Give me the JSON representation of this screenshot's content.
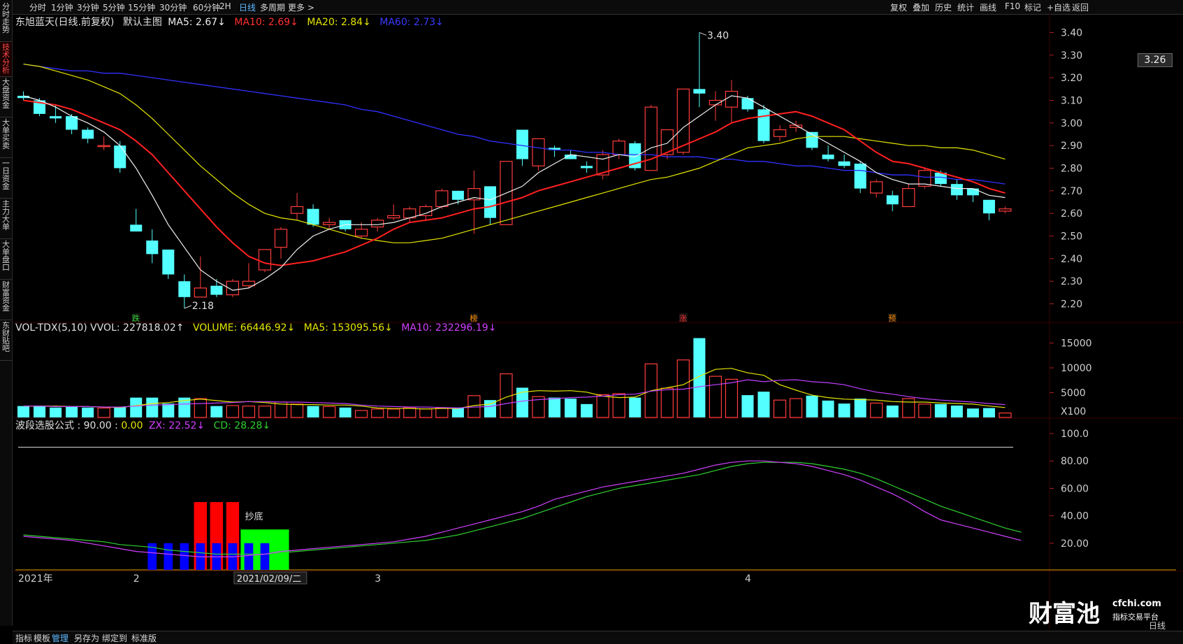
{
  "side_tabs": [
    "分时走势",
    "技术分析",
    "大盘资金",
    "大单买卖",
    "一日资金",
    "主力大单",
    "大单盘口",
    "财富资金",
    "东财贴吧"
  ],
  "side_active": 1,
  "periods": [
    "分时",
    "1分钟",
    "3分钟",
    "5分钟",
    "15分钟",
    "30分钟",
    "60分钟",
    "2H",
    "日线",
    "多周期",
    "更多 >"
  ],
  "period_active": 8,
  "right_tools": [
    "复权",
    "叠加",
    "历史",
    "统计",
    "画线",
    "F10",
    "标记",
    "+自选",
    "返回"
  ],
  "bottom_tools": [
    "指标",
    "模板",
    "管理",
    "另存为",
    "绑定到",
    "标准版"
  ],
  "bottom_active": 2,
  "colors": {
    "up": "#ff3c3c",
    "down": "#54ffff",
    "ma5": "#f0f0f0",
    "ma10": "#ff2020",
    "ma20": "#e5e500",
    "ma60": "#3030ff",
    "vol_ma5": "#e5e500",
    "vol_ma10": "#c040ff",
    "zx": "#d040ff",
    "cd": "#30d030"
  },
  "main_legend": {
    "stock": "东旭蓝天(日线.前复权)",
    "template": "默认主图",
    "ma5": "MA5: 2.67↓",
    "ma10": "MA10: 2.69↓",
    "ma20": "MA20: 2.84↓",
    "ma60": "MA60: 2.73↓"
  },
  "vol_legend": {
    "name": "VOL-TDX(5,10) VVOL: 227818.02↑",
    "volume": "VOLUME: 66446.92↓",
    "ma5": "MA5: 153095.56↓",
    "ma10": "MA10: 232296.19↓"
  },
  "ind_legend": {
    "name": "波段选股公式 : 90.00 :",
    "v0": "0.00",
    "zx": "ZX: 22.52↓",
    "cd": "CD: 28.28↓"
  },
  "current_price": "3.26",
  "annotations": {
    "high": "3.40",
    "low": "2.18",
    "signal": "抄底",
    "date_cursor": "2021/02/09/二"
  },
  "markers": [
    "跌",
    "榜",
    "涨",
    "预"
  ],
  "watermark": {
    "brand": "财富池",
    "url": "cfchi.com",
    "tag": "指标交易平台",
    "period": "日线"
  },
  "chart_data": {
    "type": "candlestick",
    "price_axis": {
      "ylim": [
        2.18,
        3.42
      ],
      "ticks": [
        "3.40",
        "3.30",
        "3.20",
        "3.10",
        "3.00",
        "2.90",
        "2.80",
        "2.70",
        "2.60",
        "2.50",
        "2.40",
        "2.30",
        "2.20"
      ]
    },
    "x_labels": [
      {
        "label": "2021年",
        "index": 0
      },
      {
        "label": "2",
        "index": 7
      },
      {
        "label": "3",
        "index": 22
      },
      {
        "label": "4",
        "index": 45
      }
    ],
    "candles": [
      {
        "o": 3.12,
        "c": 3.11,
        "h": 3.14,
        "l": 3.1
      },
      {
        "o": 3.1,
        "c": 3.04,
        "h": 3.11,
        "l": 3.03
      },
      {
        "o": 3.03,
        "c": 3.02,
        "h": 3.08,
        "l": 3.0
      },
      {
        "o": 3.03,
        "c": 2.97,
        "h": 3.04,
        "l": 2.95
      },
      {
        "o": 2.97,
        "c": 2.93,
        "h": 2.98,
        "l": 2.91
      },
      {
        "o": 2.9,
        "c": 2.9,
        "h": 2.94,
        "l": 2.88
      },
      {
        "o": 2.9,
        "c": 2.8,
        "h": 2.92,
        "l": 2.78
      },
      {
        "o": 2.55,
        "c": 2.52,
        "h": 2.62,
        "l": 2.52
      },
      {
        "o": 2.48,
        "c": 2.42,
        "h": 2.53,
        "l": 2.38
      },
      {
        "o": 2.44,
        "c": 2.33,
        "h": 2.44,
        "l": 2.31
      },
      {
        "o": 2.3,
        "c": 2.23,
        "h": 2.33,
        "l": 2.18
      },
      {
        "o": 2.23,
        "c": 2.27,
        "h": 2.41,
        "l": 2.23
      },
      {
        "o": 2.28,
        "c": 2.24,
        "h": 2.31,
        "l": 2.23
      },
      {
        "o": 2.24,
        "c": 2.3,
        "h": 2.31,
        "l": 2.23
      },
      {
        "o": 2.28,
        "c": 2.3,
        "h": 2.38,
        "l": 2.27
      },
      {
        "o": 2.35,
        "c": 2.44,
        "h": 2.44,
        "l": 2.34
      },
      {
        "o": 2.45,
        "c": 2.53,
        "h": 2.54,
        "l": 2.4
      },
      {
        "o": 2.6,
        "c": 2.63,
        "h": 2.69,
        "l": 2.57
      },
      {
        "o": 2.62,
        "c": 2.55,
        "h": 2.64,
        "l": 2.54
      },
      {
        "o": 2.55,
        "c": 2.56,
        "h": 2.58,
        "l": 2.53
      },
      {
        "o": 2.57,
        "c": 2.53,
        "h": 2.57,
        "l": 2.52
      },
      {
        "o": 2.5,
        "c": 2.53,
        "h": 2.56,
        "l": 2.49
      },
      {
        "o": 2.54,
        "c": 2.57,
        "h": 2.58,
        "l": 2.52
      },
      {
        "o": 2.58,
        "c": 2.59,
        "h": 2.64,
        "l": 2.57
      },
      {
        "o": 2.58,
        "c": 2.62,
        "h": 2.63,
        "l": 2.56
      },
      {
        "o": 2.59,
        "c": 2.63,
        "h": 2.64,
        "l": 2.57
      },
      {
        "o": 2.63,
        "c": 2.7,
        "h": 2.71,
        "l": 2.62
      },
      {
        "o": 2.7,
        "c": 2.66,
        "h": 2.7,
        "l": 2.64
      },
      {
        "o": 2.66,
        "c": 2.71,
        "h": 2.79,
        "l": 2.51
      },
      {
        "o": 2.72,
        "c": 2.58,
        "h": 2.72,
        "l": 2.55
      },
      {
        "o": 2.55,
        "c": 2.83,
        "h": 2.83,
        "l": 2.55
      },
      {
        "o": 2.97,
        "c": 2.84,
        "h": 2.97,
        "l": 2.81
      },
      {
        "o": 2.81,
        "c": 2.93,
        "h": 2.93,
        "l": 2.79
      },
      {
        "o": 2.89,
        "c": 2.88,
        "h": 2.9,
        "l": 2.85
      },
      {
        "o": 2.86,
        "c": 2.84,
        "h": 2.88,
        "l": 2.84
      },
      {
        "o": 2.81,
        "c": 2.8,
        "h": 2.83,
        "l": 2.78
      },
      {
        "o": 2.77,
        "c": 2.86,
        "h": 2.88,
        "l": 2.75
      },
      {
        "o": 2.86,
        "c": 2.92,
        "h": 2.93,
        "l": 2.84
      },
      {
        "o": 2.91,
        "c": 2.8,
        "h": 2.92,
        "l": 2.79
      },
      {
        "o": 2.79,
        "c": 3.07,
        "h": 3.08,
        "l": 2.79
      },
      {
        "o": 2.86,
        "c": 2.97,
        "h": 2.97,
        "l": 2.84
      },
      {
        "o": 2.87,
        "c": 3.15,
        "h": 3.15,
        "l": 2.86
      },
      {
        "o": 3.15,
        "c": 3.13,
        "h": 3.4,
        "l": 3.07
      },
      {
        "o": 3.08,
        "c": 3.1,
        "h": 3.14,
        "l": 3.01
      },
      {
        "o": 3.07,
        "c": 3.14,
        "h": 3.19,
        "l": 3.0
      },
      {
        "o": 3.11,
        "c": 3.06,
        "h": 3.12,
        "l": 3.05
      },
      {
        "o": 3.06,
        "c": 2.92,
        "h": 3.08,
        "l": 2.91
      },
      {
        "o": 2.94,
        "c": 2.97,
        "h": 2.99,
        "l": 2.92
      },
      {
        "o": 2.98,
        "c": 2.99,
        "h": 3.01,
        "l": 2.96
      },
      {
        "o": 2.96,
        "c": 2.89,
        "h": 2.96,
        "l": 2.88
      },
      {
        "o": 2.86,
        "c": 2.84,
        "h": 2.9,
        "l": 2.83
      },
      {
        "o": 2.83,
        "c": 2.81,
        "h": 2.86,
        "l": 2.8
      },
      {
        "o": 2.82,
        "c": 2.71,
        "h": 2.83,
        "l": 2.69
      },
      {
        "o": 2.69,
        "c": 2.74,
        "h": 2.75,
        "l": 2.67
      },
      {
        "o": 2.68,
        "c": 2.64,
        "h": 2.7,
        "l": 2.61
      },
      {
        "o": 2.63,
        "c": 2.71,
        "h": 2.73,
        "l": 2.63
      },
      {
        "o": 2.72,
        "c": 2.79,
        "h": 2.8,
        "l": 2.71
      },
      {
        "o": 2.78,
        "c": 2.73,
        "h": 2.79,
        "l": 2.72
      },
      {
        "o": 2.73,
        "c": 2.68,
        "h": 2.75,
        "l": 2.66
      },
      {
        "o": 2.71,
        "c": 2.68,
        "h": 2.71,
        "l": 2.65
      },
      {
        "o": 2.66,
        "c": 2.6,
        "h": 2.66,
        "l": 2.57
      },
      {
        "o": 2.61,
        "c": 2.62,
        "h": 2.63,
        "l": 2.6
      }
    ],
    "ma5": [
      3.12,
      3.1,
      3.07,
      3.03,
      3.0,
      2.96,
      2.9,
      2.8,
      2.68,
      2.55,
      2.45,
      2.35,
      2.3,
      2.26,
      2.27,
      2.31,
      2.36,
      2.44,
      2.5,
      2.53,
      2.55,
      2.55,
      2.55,
      2.56,
      2.58,
      2.6,
      2.63,
      2.65,
      2.67,
      2.66,
      2.69,
      2.72,
      2.78,
      2.82,
      2.86,
      2.85,
      2.84,
      2.86,
      2.85,
      2.89,
      2.91,
      2.98,
      3.03,
      3.08,
      3.12,
      3.11,
      3.07,
      3.03,
      2.99,
      2.95,
      2.91,
      2.87,
      2.83,
      2.78,
      2.75,
      2.73,
      2.73,
      2.72,
      2.71,
      2.71,
      2.68,
      2.67
    ],
    "ma10": [
      3.1,
      3.09,
      3.08,
      3.06,
      3.03,
      3.0,
      2.97,
      2.92,
      2.86,
      2.78,
      2.7,
      2.62,
      2.54,
      2.47,
      2.41,
      2.38,
      2.37,
      2.38,
      2.39,
      2.41,
      2.43,
      2.46,
      2.49,
      2.53,
      2.56,
      2.57,
      2.58,
      2.6,
      2.62,
      2.63,
      2.65,
      2.67,
      2.7,
      2.72,
      2.74,
      2.76,
      2.78,
      2.8,
      2.82,
      2.84,
      2.87,
      2.9,
      2.93,
      2.96,
      3.0,
      3.02,
      3.03,
      3.04,
      3.05,
      3.03,
      3.0,
      2.97,
      2.92,
      2.87,
      2.83,
      2.82,
      2.8,
      2.78,
      2.76,
      2.74,
      2.71,
      2.69
    ],
    "ma20": [
      3.26,
      3.25,
      3.23,
      3.21,
      3.19,
      3.16,
      3.13,
      3.08,
      3.02,
      2.95,
      2.88,
      2.81,
      2.75,
      2.69,
      2.64,
      2.6,
      2.58,
      2.57,
      2.55,
      2.53,
      2.51,
      2.49,
      2.48,
      2.47,
      2.47,
      2.48,
      2.49,
      2.51,
      2.53,
      2.55,
      2.57,
      2.59,
      2.61,
      2.63,
      2.65,
      2.67,
      2.69,
      2.71,
      2.73,
      2.75,
      2.76,
      2.78,
      2.8,
      2.83,
      2.86,
      2.89,
      2.9,
      2.91,
      2.93,
      2.94,
      2.94,
      2.94,
      2.93,
      2.92,
      2.91,
      2.9,
      2.9,
      2.89,
      2.89,
      2.88,
      2.86,
      2.84
    ],
    "ma60": [
      3.26,
      3.25,
      3.24,
      3.23,
      3.23,
      3.22,
      3.22,
      3.21,
      3.2,
      3.19,
      3.18,
      3.17,
      3.16,
      3.15,
      3.14,
      3.13,
      3.12,
      3.11,
      3.1,
      3.09,
      3.08,
      3.06,
      3.05,
      3.03,
      3.01,
      2.99,
      2.97,
      2.95,
      2.94,
      2.92,
      2.91,
      2.9,
      2.89,
      2.88,
      2.88,
      2.87,
      2.87,
      2.86,
      2.86,
      2.86,
      2.85,
      2.85,
      2.85,
      2.84,
      2.84,
      2.83,
      2.83,
      2.82,
      2.81,
      2.81,
      2.8,
      2.79,
      2.79,
      2.78,
      2.77,
      2.77,
      2.76,
      2.76,
      2.75,
      2.75,
      2.74,
      2.73
    ],
    "volume_axis": {
      "ylim": [
        0,
        16500
      ],
      "ticks": [
        "15000",
        "10000",
        "5000"
      ],
      "unit": "X100"
    },
    "volume": [
      2300,
      2300,
      2000,
      2200,
      2000,
      1900,
      2100,
      4000,
      4000,
      2800,
      4000,
      3800,
      2300,
      2400,
      2300,
      2300,
      3100,
      2700,
      2300,
      2200,
      2000,
      1400,
      1700,
      1700,
      2000,
      1700,
      1900,
      2000,
      4400,
      3500,
      8800,
      6000,
      4200,
      4000,
      3800,
      2700,
      4600,
      4800,
      4000,
      10800,
      5900,
      11600,
      16000,
      8300,
      7700,
      4500,
      5200,
      3500,
      3800,
      4400,
      3400,
      2800,
      3800,
      2900,
      2400,
      3800,
      2700,
      2700,
      2400,
      1800,
      1900,
      900
    ],
    "volume_ma5": [
      2300,
      2300,
      2300,
      2200,
      2200,
      2100,
      2000,
      2400,
      2800,
      3000,
      3400,
      3700,
      3400,
      3100,
      3200,
      3000,
      2700,
      2600,
      2600,
      2500,
      2500,
      2300,
      1900,
      1800,
      1800,
      1700,
      1800,
      1800,
      2400,
      2700,
      4100,
      5100,
      5400,
      5300,
      5400,
      5100,
      4300,
      4000,
      4100,
      5400,
      6000,
      6600,
      8300,
      9700,
      9900,
      9000,
      8500,
      6600,
      5500,
      4500,
      4000,
      3700,
      3600,
      3500,
      3200,
      3100,
      3100,
      2900,
      2800,
      2700,
      2300,
      2000
    ],
    "volume_ma10": [
      2300,
      2300,
      2200,
      2200,
      2200,
      2100,
      2100,
      2300,
      2500,
      2600,
      2700,
      2800,
      2900,
      3000,
      3200,
      3200,
      3100,
      3100,
      3000,
      2900,
      2800,
      2500,
      2300,
      2200,
      2100,
      2100,
      2000,
      1900,
      2100,
      2200,
      2800,
      3300,
      3600,
      3800,
      4000,
      4100,
      4300,
      4600,
      4700,
      5300,
      5600,
      5700,
      6200,
      6600,
      7000,
      7600,
      7200,
      7500,
      7600,
      7200,
      7000,
      6600,
      5800,
      5100,
      4700,
      4200,
      3800,
      3500,
      3300,
      3100,
      2800,
      2600
    ],
    "indicator_axis": {
      "ylim": [
        0,
        100
      ],
      "ticks": [
        "100.0",
        "80.00",
        "60.00",
        "40.00",
        "20.00"
      ],
      "ref_line": 90
    },
    "zx": [
      25,
      24,
      23,
      22,
      20,
      18,
      16,
      14,
      13,
      12,
      11,
      10,
      10,
      10,
      11,
      12,
      14,
      15,
      16,
      17,
      18,
      19,
      20,
      21,
      23,
      25,
      28,
      31,
      34,
      37,
      40,
      43,
      47,
      52,
      55,
      58,
      61,
      63,
      65,
      67,
      69,
      71,
      74,
      77,
      79,
      80,
      80,
      79,
      78,
      76,
      73,
      70,
      66,
      61,
      56,
      50,
      43,
      37,
      34,
      31,
      28,
      25,
      22
    ],
    "cd": [
      26,
      25,
      24,
      23,
      22,
      21,
      19,
      18,
      17,
      15,
      14,
      13,
      12,
      12,
      12,
      12,
      13,
      14,
      15,
      16,
      17,
      18,
      19,
      20,
      21,
      22,
      24,
      26,
      29,
      32,
      35,
      38,
      42,
      46,
      50,
      54,
      57,
      60,
      62,
      64,
      66,
      68,
      70,
      73,
      76,
      78,
      79,
      79,
      79,
      78,
      76,
      74,
      71,
      67,
      62,
      57,
      52,
      47,
      43,
      39,
      35,
      31,
      28
    ],
    "signal_bars": [
      {
        "index": 8,
        "color": "blue",
        "value": 20
      },
      {
        "index": 9,
        "color": "blue",
        "value": 20
      },
      {
        "index": 10,
        "color": "blue",
        "value": 20
      },
      {
        "index": 11,
        "color": "red",
        "value": 50
      },
      {
        "index": 11,
        "color": "blue",
        "value": 20
      },
      {
        "index": 12,
        "color": "red",
        "value": 50
      },
      {
        "index": 12,
        "color": "blue",
        "value": 20
      },
      {
        "index": 13,
        "color": "red",
        "value": 50
      },
      {
        "index": 13,
        "color": "blue",
        "value": 20
      },
      {
        "index": 14,
        "color": "blue",
        "value": 20
      },
      {
        "index": 15,
        "color": "blue",
        "value": 20
      }
    ],
    "signal_box": {
      "from": 14,
      "to": 16,
      "value": 30,
      "color": "green"
    }
  }
}
